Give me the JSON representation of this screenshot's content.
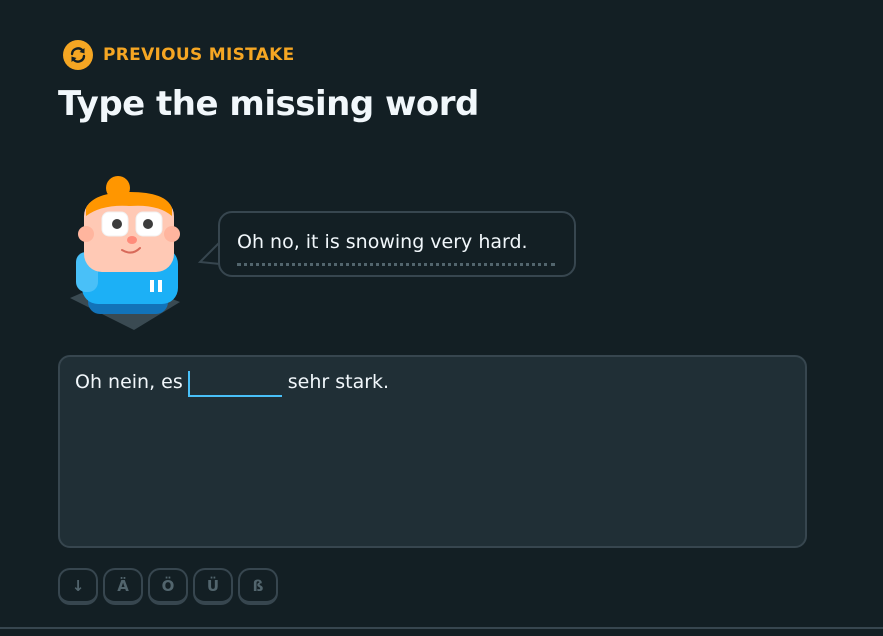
{
  "header": {
    "badge_icon": "repeat-icon",
    "badge_label": "PREVIOUS MISTAKE",
    "badge_color": "#f5a623"
  },
  "title": "Type the missing word",
  "prompt": {
    "speech_text": "Oh no, it is snowing very hard."
  },
  "answer": {
    "before_blank": "Oh nein, es",
    "blank_value": "",
    "after_blank": "sehr stark.",
    "accent_color": "#49c0f8"
  },
  "special_keys": [
    "↓",
    "Ä",
    "Ö",
    "Ü",
    "ß"
  ]
}
